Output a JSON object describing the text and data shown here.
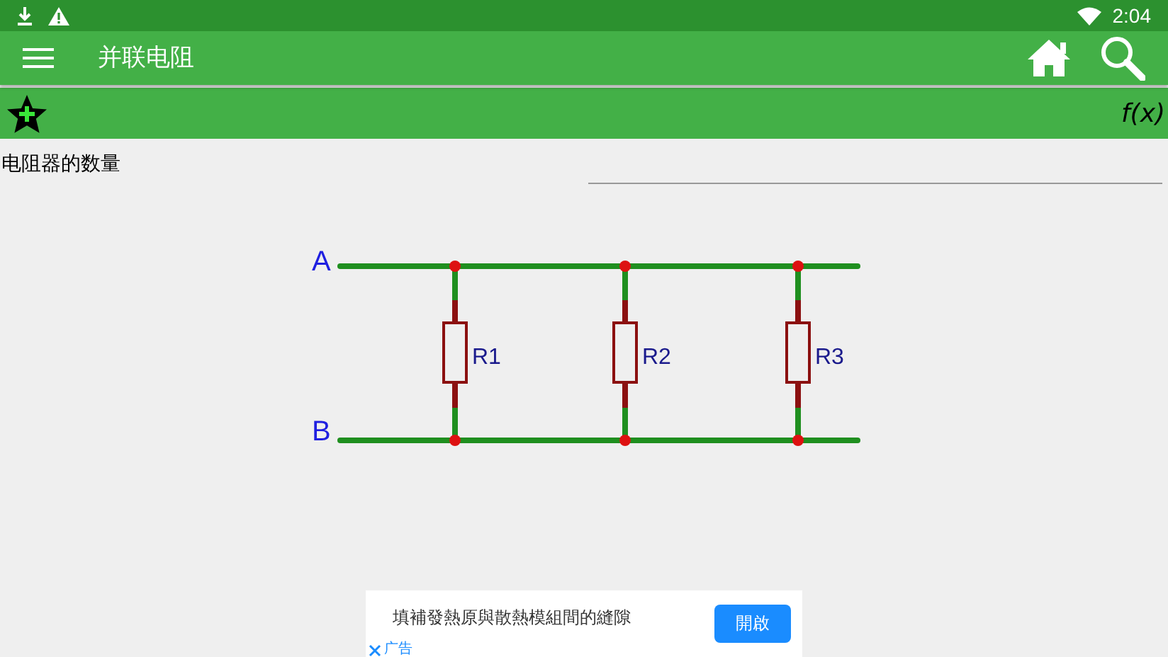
{
  "status_bar": {
    "time": "2:04"
  },
  "app_bar": {
    "title": "并联电阻"
  },
  "toolbar": {
    "formula_button": "f(x)"
  },
  "input": {
    "label": "电阻器的数量"
  },
  "circuit": {
    "terminals": [
      "A",
      "B"
    ],
    "resistors": [
      {
        "label": "R1"
      },
      {
        "label": "R2"
      },
      {
        "label": "R3"
      }
    ]
  },
  "ad": {
    "text": "填補發熱原與散熱模組間的縫隙",
    "button": "開啟",
    "tag": "广告"
  }
}
